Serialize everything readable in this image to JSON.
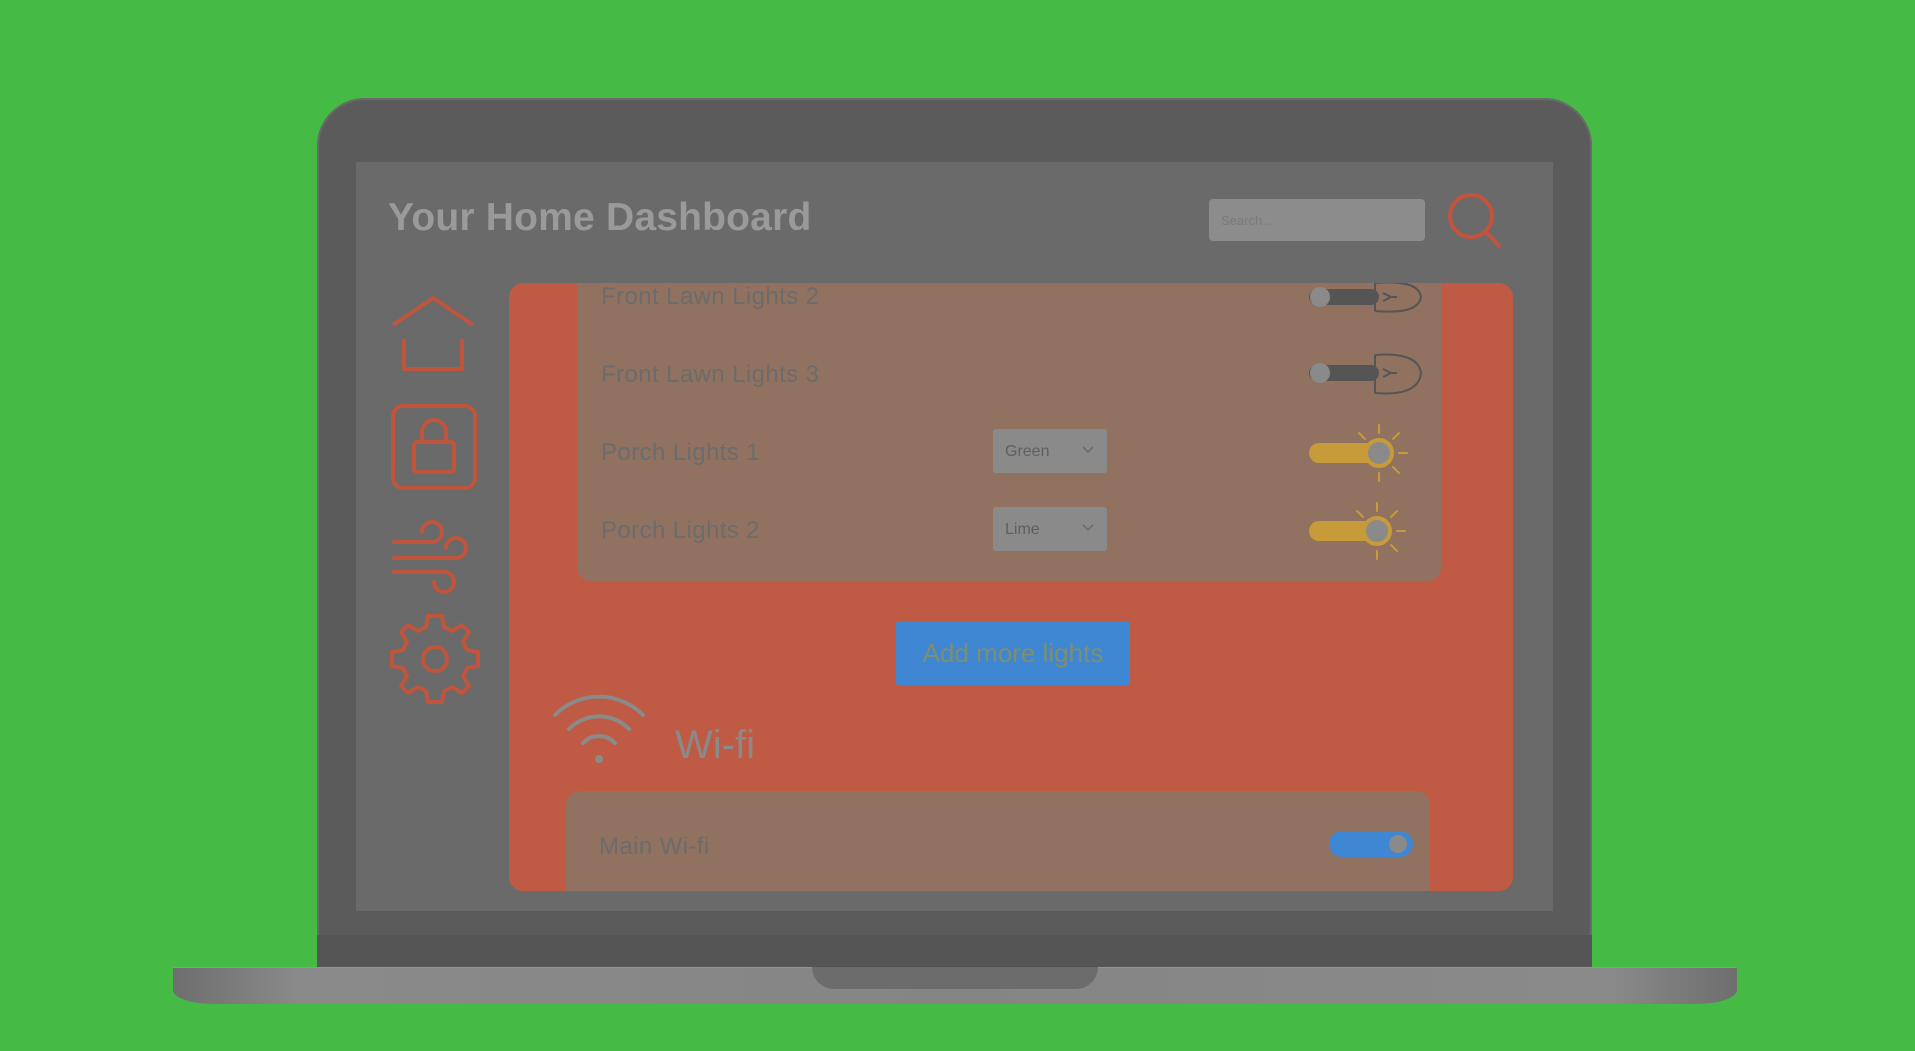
{
  "header": {
    "title": "Your Home Dashboard",
    "search_placeholder": "Search...",
    "search_icon": "magnifier-icon"
  },
  "sidebar": {
    "items": [
      {
        "name": "home",
        "icon": "home-icon"
      },
      {
        "name": "security",
        "icon": "lock-icon"
      },
      {
        "name": "climate",
        "icon": "wind-icon"
      },
      {
        "name": "settings",
        "icon": "gear-icon"
      }
    ]
  },
  "lights": {
    "items": [
      {
        "label": "Front Lawn Lights 2",
        "on": false
      },
      {
        "label": "Front Lawn Lights 3",
        "on": false
      },
      {
        "label": "Porch Lights 1",
        "color": "Green",
        "on": true
      },
      {
        "label": "Porch Lights 2",
        "color": "Lime",
        "on": true
      }
    ],
    "add_button": "Add more lights"
  },
  "wifi": {
    "title": "Wi-fi",
    "icon": "wifi-icon",
    "networks": [
      {
        "label": "Main Wi-fi",
        "on": true
      }
    ]
  },
  "colors": {
    "background": "#45bb46",
    "accent": "#bf5b44",
    "card": "#917260",
    "toggle_on": "#c79a3a",
    "wifi_toggle": "#3f86d3"
  }
}
